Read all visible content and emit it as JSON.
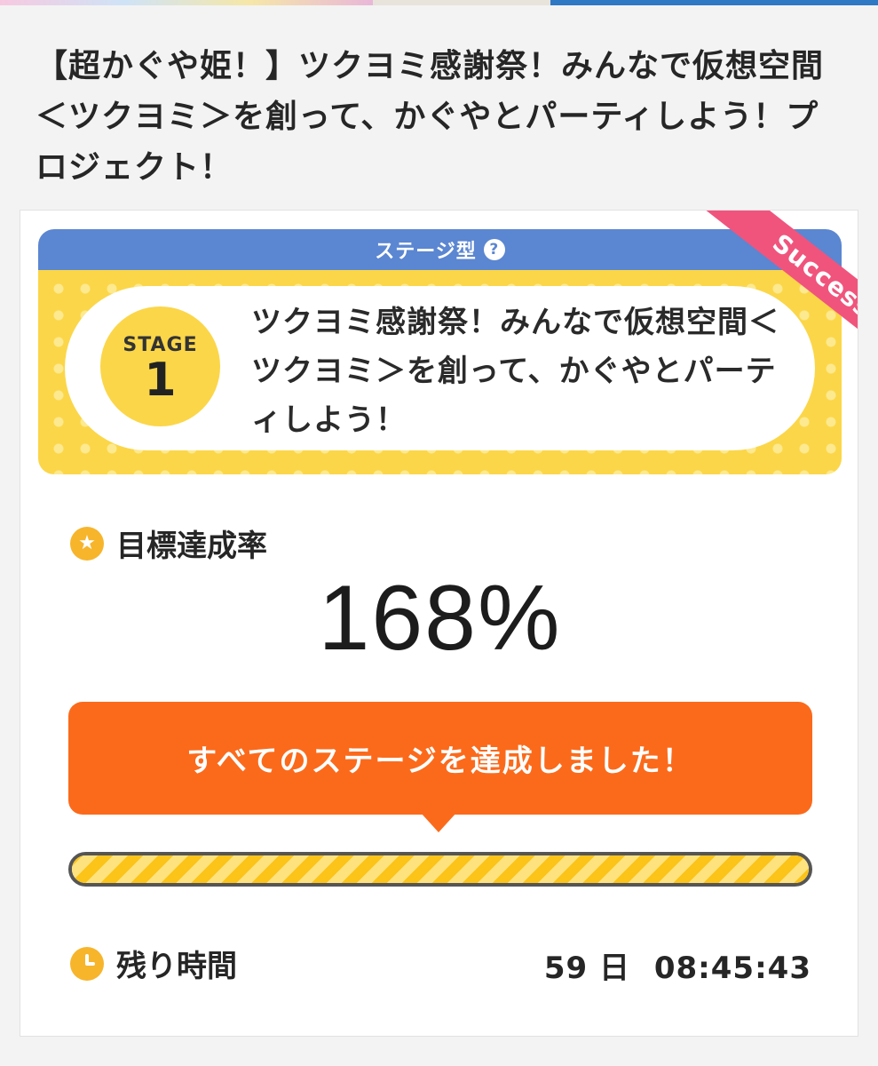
{
  "project": {
    "title": "【超かぐや姫！】ツクヨミ感謝祭！みんなで仮想空間＜ツクヨミ＞を創って、かぐやとパーティしよう！プロジェクト！"
  },
  "stage": {
    "type_label": "ステージ型",
    "help_icon": "?",
    "badge_label": "STAGE",
    "badge_number": "1",
    "title": "ツクヨミ感謝祭！みんなで仮想空間＜ツクヨミ＞を創って、かぐやとパーティしよう！",
    "status_ribbon": "Success"
  },
  "goal": {
    "label": "目標達成率",
    "value": "168%",
    "progress_fraction": 1.0
  },
  "banner": {
    "message": "すべてのステージを達成しました！"
  },
  "remaining": {
    "label": "残り時間",
    "days": "59 日",
    "time": "08:45:43"
  },
  "colors": {
    "stage_header": "#5b86d1",
    "stage_bg": "#fbd648",
    "ribbon": "#f0547d",
    "banner": "#fb6a1b",
    "icon": "#f7b52c"
  },
  "icons": {
    "goal": "star-icon",
    "remaining": "clock-icon",
    "help": "question-circle-icon"
  }
}
